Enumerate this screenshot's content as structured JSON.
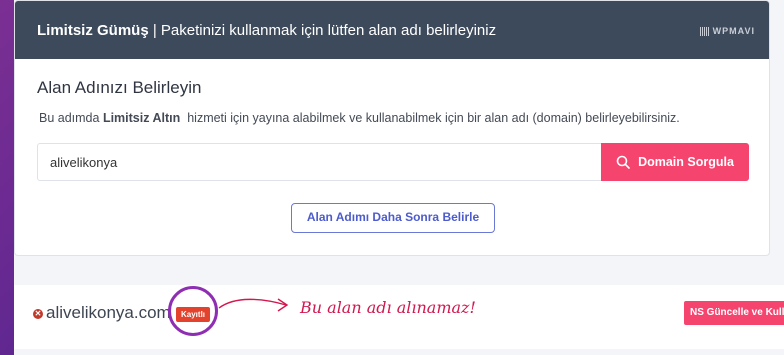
{
  "header": {
    "brand": "Limitsiz Gümüş",
    "separator": " | ",
    "message": "Paketinizi kullanmak için lütfen alan adı belirleyiniz",
    "logo_text": "WPMAVI"
  },
  "domain_section": {
    "title": "Alan Adınızı Belirleyin",
    "desc_prefix": "Bu adımda ",
    "desc_bold": "Limitsiz Altın",
    "desc_suffix": "  hizmeti için yayına alabilmek ve kullanabilmek için bir alan adı (domain) belirleyebilirsiniz.",
    "search_value": "alivelikonya",
    "search_button": "Domain Sorgula",
    "later_button": "Alan Adımı Daha Sonra Belirle"
  },
  "result": {
    "domain": "alivelikonya.com",
    "status_badge": "Kayıtlı",
    "annotation": "Bu alan adı alınamaz!",
    "ns_button": "NS Güncelle ve Kull"
  },
  "colors": {
    "header_bg": "#3d4a5c",
    "accent_pink": "#f5456f",
    "outline_blue": "#6a78d6",
    "badge_red": "#e3432d",
    "circle_purple": "#8e2fb3",
    "annotation_red": "#d2184f"
  },
  "icons": {
    "search": "search-icon",
    "error": "close-circle-icon",
    "logo": "wpmavi-logo"
  }
}
